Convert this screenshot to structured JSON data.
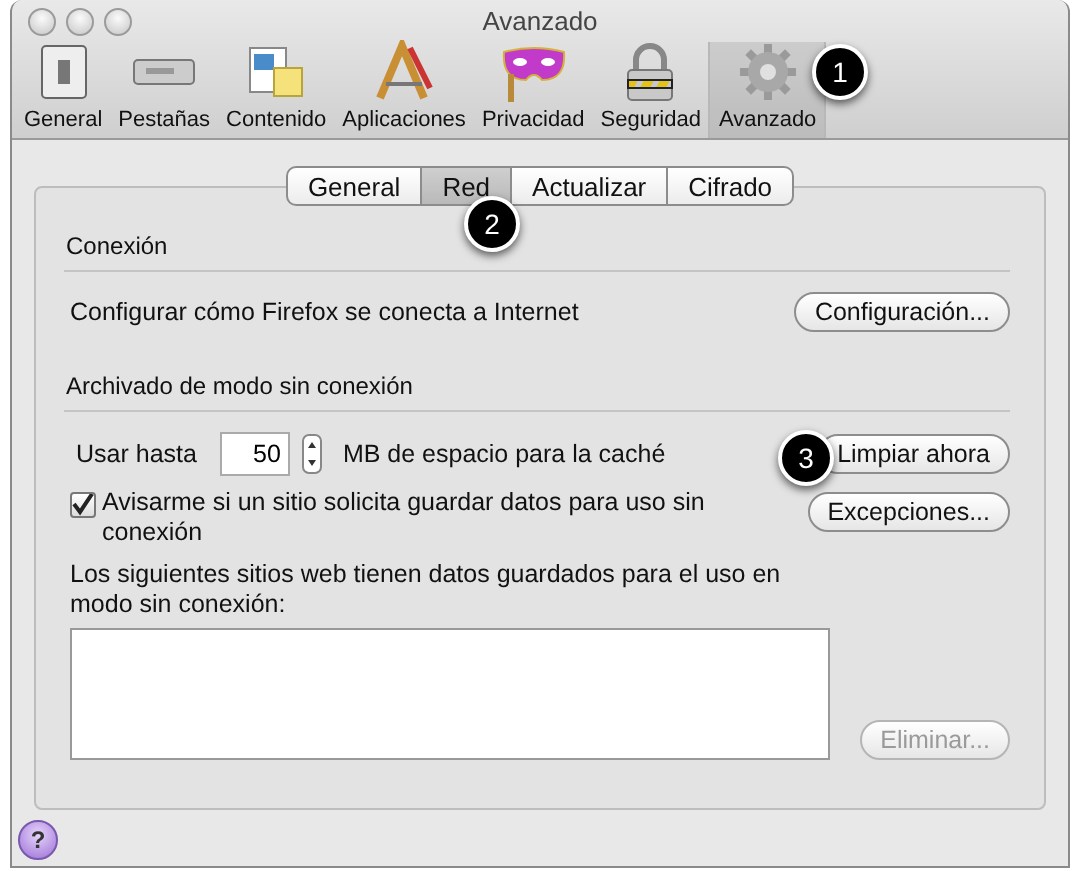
{
  "window": {
    "title": "Avanzado"
  },
  "toolbar": [
    {
      "label": "General",
      "selected": false
    },
    {
      "label": "Pestañas",
      "selected": false
    },
    {
      "label": "Contenido",
      "selected": false
    },
    {
      "label": "Aplicaciones",
      "selected": false
    },
    {
      "label": "Privacidad",
      "selected": false
    },
    {
      "label": "Seguridad",
      "selected": false
    },
    {
      "label": "Avanzado",
      "selected": true
    }
  ],
  "tabs": [
    {
      "label": "General",
      "selected": false
    },
    {
      "label": "Red",
      "selected": true
    },
    {
      "label": "Actualizar",
      "selected": false
    },
    {
      "label": "Cifrado",
      "selected": false
    }
  ],
  "connection": {
    "heading": "Conexión",
    "description": "Configurar cómo Firefox se conecta a Internet",
    "button": "Configuración..."
  },
  "offline": {
    "heading": "Archivado de modo sin conexión",
    "use_label": "Usar hasta",
    "cache_value": "50",
    "cache_unit": "MB de espacio para la caché",
    "clear_button": "Limpiar ahora",
    "notify": {
      "label": "Avisarme si un sitio solicita guardar datos para uso sin conexión",
      "checked": true
    },
    "exceptions_button": "Excepciones...",
    "sites_label": "Los siguientes sitios web tienen datos guardados para el uso en modo sin conexión:",
    "remove_button": {
      "label": "Eliminar...",
      "disabled": true
    }
  },
  "help_button": "?",
  "callouts": [
    "1",
    "2",
    "3"
  ]
}
